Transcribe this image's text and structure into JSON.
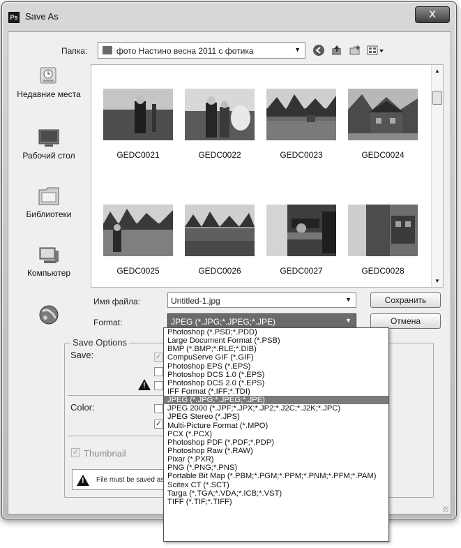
{
  "window": {
    "title": "Save As",
    "app_badge": "Ps",
    "close_label": "x"
  },
  "lookin": {
    "label": "Папка:",
    "value": "фото Настино весна 2011 с фотика"
  },
  "places": [
    {
      "label": "Недавние места",
      "icon": "recent-places-icon"
    },
    {
      "label": "Рабочий стол",
      "icon": "desktop-icon"
    },
    {
      "label": "Библиотеки",
      "icon": "libraries-icon"
    },
    {
      "label": "Компьютер",
      "icon": "computer-icon"
    },
    {
      "label": "",
      "icon": "network-icon"
    }
  ],
  "files": [
    {
      "name": "GEDC0021"
    },
    {
      "name": "GEDC0022"
    },
    {
      "name": "GEDC0023"
    },
    {
      "name": "GEDC0024"
    },
    {
      "name": "GEDC0025"
    },
    {
      "name": "GEDC0026"
    },
    {
      "name": "GEDC0027"
    },
    {
      "name": "GEDC0028"
    }
  ],
  "filename": {
    "label": "Имя файла:",
    "value": "Untitled-1.jpg"
  },
  "format": {
    "label": "Format:",
    "value": "JPEG (*.JPG;*.JPEG;*.JPE)"
  },
  "buttons": {
    "save": "Сохранить",
    "cancel": "Отмена"
  },
  "save_options": {
    "title": "Save Options",
    "save_label": "Save:",
    "color_label": "Color:",
    "thumbnail_label": "Thumbnail",
    "notice": "File must be saved as"
  },
  "format_list": [
    "Photoshop (*.PSD;*.PDD)",
    "Large Document Format (*.PSB)",
    "BMP (*.BMP;*.RLE;*.DIB)",
    "CompuServe GIF (*.GIF)",
    "Photoshop EPS (*.EPS)",
    "Photoshop DCS 1.0 (*.EPS)",
    "Photoshop DCS 2.0 (*.EPS)",
    "IFF Format (*.IFF;*.TDI)",
    "JPEG (*.JPG;*.JPEG;*.JPE)",
    "JPEG 2000 (*.JPF;*.JPX;*.JP2;*.J2C;*.J2K;*.JPC)",
    "JPEG Stereo (*.JPS)",
    "Multi-Picture Format (*.MPO)",
    "PCX (*.PCX)",
    "Photoshop PDF (*.PDF;*.PDP)",
    "Photoshop Raw (*.RAW)",
    "Pixar (*.PXR)",
    "PNG (*.PNG;*.PNS)",
    "Portable Bit Map (*.PBM;*.PGM;*.PPM;*.PNM;*.PFM;*.PAM)",
    "Scitex CT (*.SCT)",
    "Targa (*.TGA;*.VDA;*.ICB;*.VST)",
    "TIFF (*.TIF;*.TIFF)"
  ],
  "format_list_highlight_index": 8
}
